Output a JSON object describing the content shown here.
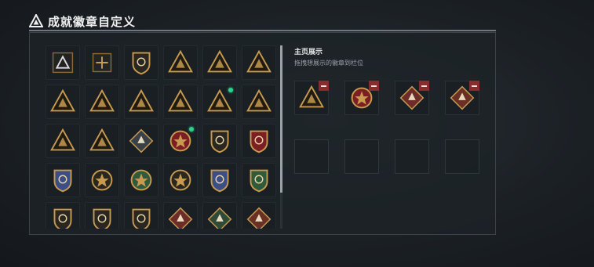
{
  "header": {
    "title": "成就徽章自定义",
    "icon": "warning-triangle-icon"
  },
  "showcase": {
    "title": "主页展示",
    "subtitle": "拖拽想展示的徽章到栏位"
  },
  "colors": {
    "gold": "#c89b50",
    "dark_gold": "#8a6a34",
    "remove": "#8a2c2c",
    "new_dot": "#2ad28a"
  },
  "badges": [
    {
      "icon": "triangle-emblem-icon",
      "new": false
    },
    {
      "icon": "helicopter-badge-icon",
      "new": false
    },
    {
      "icon": "arrow-shield-icon",
      "new": false
    },
    {
      "icon": "backpack-triangle-icon",
      "new": false
    },
    {
      "icon": "tank-triangle-icon",
      "new": false
    },
    {
      "icon": "tower-triangle-icon",
      "new": false
    },
    {
      "icon": "fist-triangle-icon",
      "new": false
    },
    {
      "icon": "ruins-triangle-icon",
      "new": false
    },
    {
      "icon": "helmet-triangle-icon",
      "new": false
    },
    {
      "icon": "number-one-triangle-icon",
      "new": false
    },
    {
      "icon": "bottle-triangle-icon",
      "new": true
    },
    {
      "icon": "mask-triangle-icon",
      "new": false
    },
    {
      "icon": "camp-triangle-icon",
      "new": false
    },
    {
      "icon": "flame-triangle-icon",
      "new": false
    },
    {
      "icon": "diamond-crest-icon",
      "new": false
    },
    {
      "icon": "star-medal-icon",
      "new": true
    },
    {
      "icon": "fist-shield-icon",
      "new": false
    },
    {
      "icon": "crowned-shield-icon",
      "new": false
    },
    {
      "icon": "blue-star-shield-icon",
      "new": false
    },
    {
      "icon": "skull-compass-icon",
      "new": false
    },
    {
      "icon": "green-wreath-icon",
      "new": false
    },
    {
      "icon": "star-compass-icon",
      "new": false
    },
    {
      "icon": "blue-eagle-shield-icon",
      "new": false
    },
    {
      "icon": "green-claw-shield-icon",
      "new": false
    },
    {
      "icon": "bullet-shield-icon",
      "new": false
    },
    {
      "icon": "no-symbol-shield-icon",
      "new": false
    },
    {
      "icon": "gold-crest-shield-icon",
      "new": false
    },
    {
      "icon": "wolf-diamond-icon",
      "new": false
    },
    {
      "icon": "bird-diamond-icon",
      "new": false
    },
    {
      "icon": "boar-diamond-icon",
      "new": false
    }
  ],
  "showcased_badges": [
    {
      "icon": "bottle-triangle-icon"
    },
    {
      "icon": "star-medal-icon"
    },
    {
      "icon": "wolf-diamond-icon"
    },
    {
      "icon": "boar-diamond-icon"
    }
  ]
}
